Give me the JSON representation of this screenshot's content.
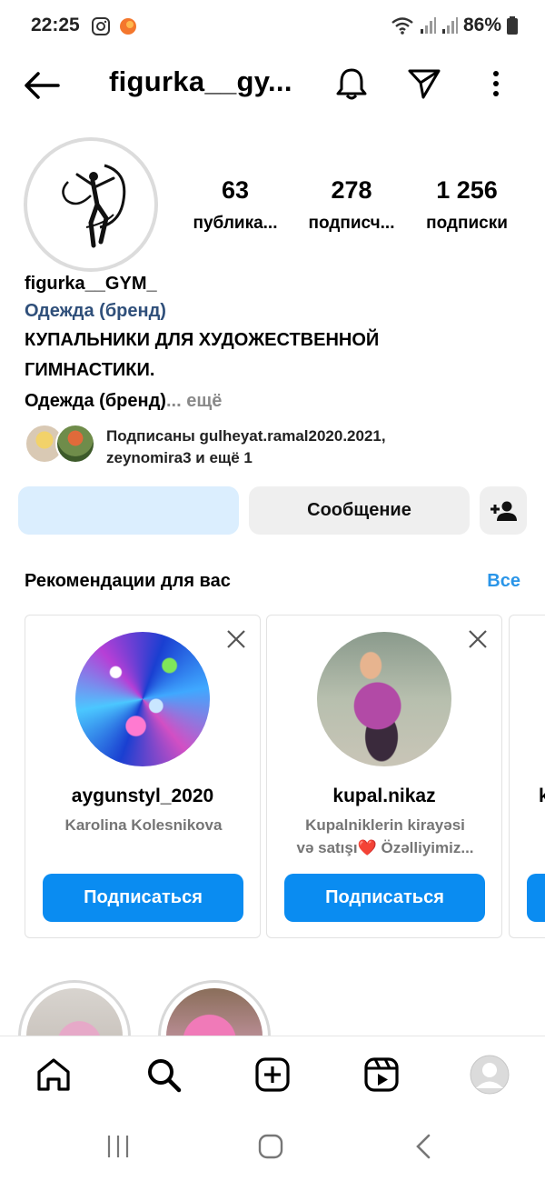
{
  "status_bar": {
    "time": "22:25",
    "battery": "86%"
  },
  "header": {
    "title": "figurka__gy...",
    "icons": [
      "back-arrow-icon",
      "bell-icon",
      "send-icon",
      "more-vert-icon"
    ]
  },
  "profile": {
    "stats": [
      {
        "value": "63",
        "label": "публика..."
      },
      {
        "value": "278",
        "label": "подписч..."
      },
      {
        "value": "1 256",
        "label": "подписки"
      }
    ],
    "username": "figurka__GYM_",
    "category": "Одежда (бренд)",
    "bio_line1": "КУПАЛЬНИКИ ДЛЯ ХУДОЖЕСТВЕННОЙ",
    "bio_line2": "ГИМНАСТИКИ.",
    "bio_line3": "Одежда (бренд)",
    "more": "... ещё",
    "followed_by_line1": "Подписаны gulheyat.ramal2020.2021,",
    "followed_by_line2": "zeynomira3 и ещё 1"
  },
  "actions": {
    "follow_label": "",
    "message_label": "Сообщение"
  },
  "recommendations": {
    "title": "Рекомендации для вас",
    "see_all": "Все",
    "cards": [
      {
        "username": "aygunstyl_2020",
        "subtitle_line1": "Karolina Kolesnikova",
        "subtitle_line2": "",
        "button": "Подписаться"
      },
      {
        "username": "kupal.nikaz",
        "subtitle_line1": "Kupalniklerin kirayəsi",
        "subtitle_line2": "və satışı❤️ Özəlliyimiz...",
        "button": "Подписаться"
      }
    ],
    "partial_card_letter": "k"
  },
  "colors": {
    "accent": "#0a8cf1",
    "link": "#2a95e8",
    "category": "#2f4f7a",
    "follow_bg": "#dbeefe"
  }
}
